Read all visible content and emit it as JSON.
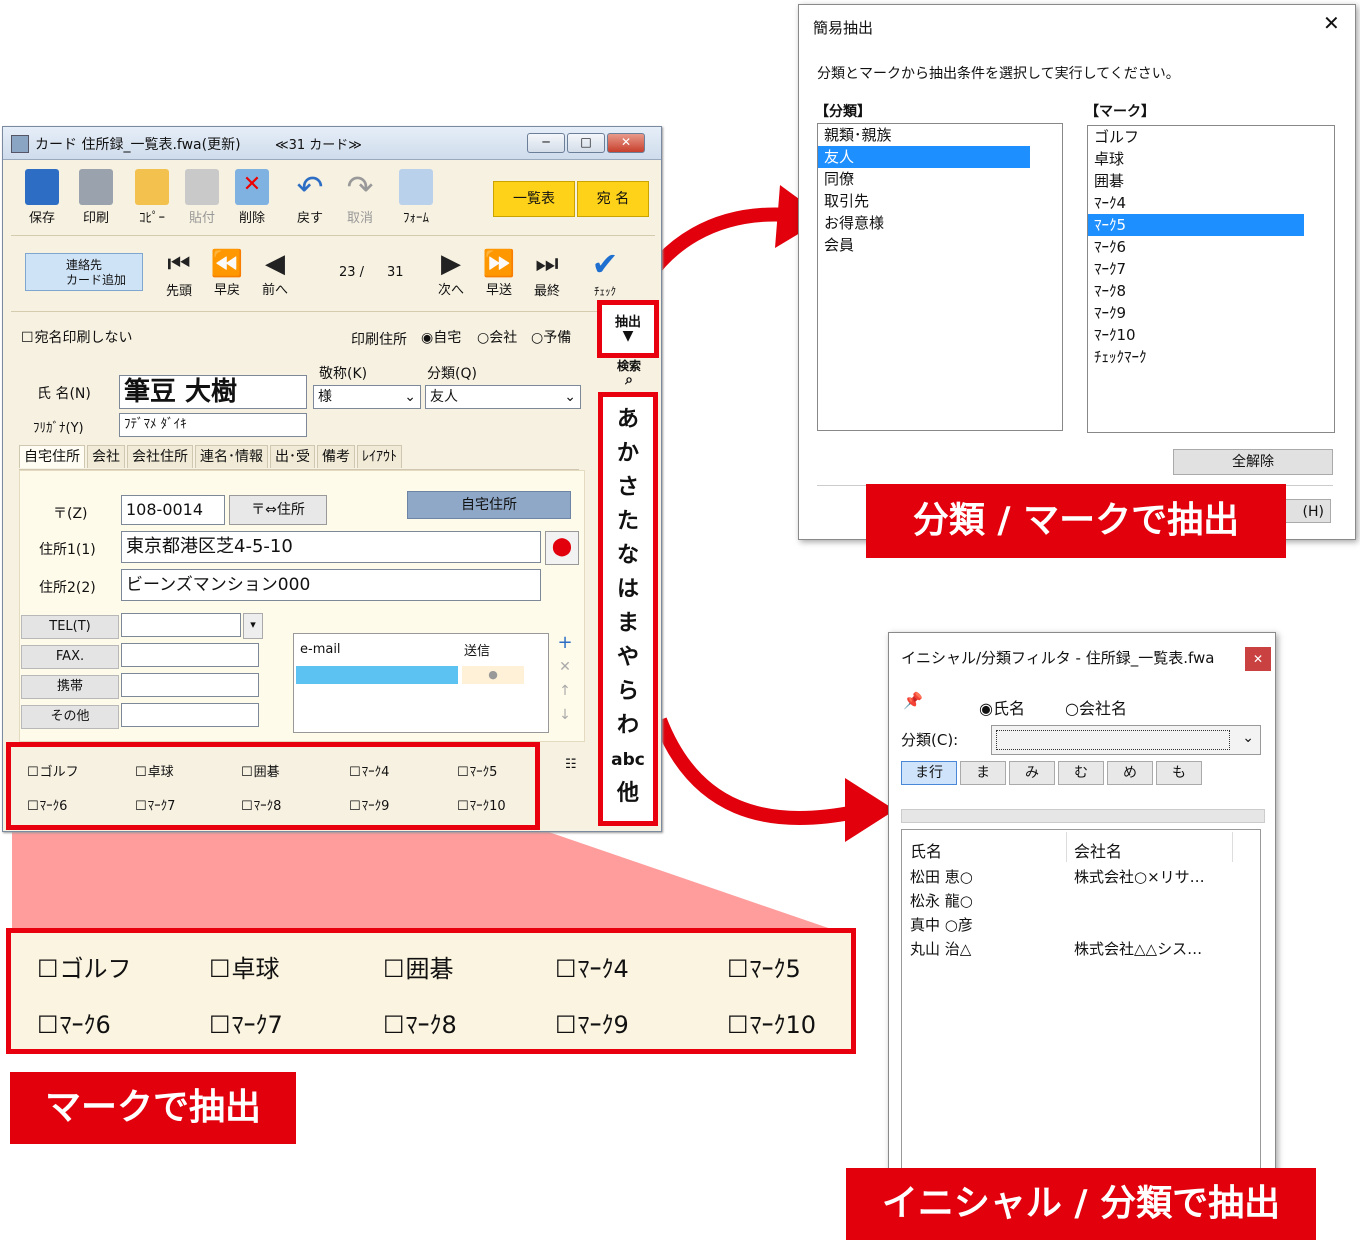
{
  "card_window": {
    "title": "カード 住所録_一覧表.fwa(更新)",
    "card_count": "≪31 カード≫",
    "toolbar": [
      "保存",
      "印刷",
      "ｺﾋﾟｰ",
      "貼付",
      "削除",
      "戻す",
      "取消",
      "ﾌｫｰﾑ"
    ],
    "list_btn": "一覧表",
    "name_btn": "宛 名",
    "add_card": "連絡先\nカード追加",
    "add_card_l1": "連絡先",
    "add_card_l2": "カード追加",
    "nav": [
      "先頭",
      "早戻",
      "前へ",
      "次へ",
      "早送",
      "最終"
    ],
    "nav_pos": "23 /",
    "nav_total": "31",
    "check_label": "ﾁｪｯｸ",
    "no_print": "宛名印刷しない",
    "print_addr_label": "印刷住所",
    "print_addr_options": [
      "自宅",
      "会社",
      "予備"
    ],
    "extract_label": "抽出",
    "search_label": "検索",
    "name_label": "氏 名(N)",
    "name_value": "筆豆 大樹",
    "kana_label": "ﾌﾘｶﾞﾅ(Y)",
    "kana_value": "ﾌﾃﾞﾏﾒ ﾀﾞｲｷ",
    "honorific_label": "敬称(K)",
    "honorific_value": "様",
    "category_label": "分類(Q)",
    "category_value": "友人",
    "tabs": [
      "自宅住所",
      "会社",
      "会社住所",
      "連名･情報",
      "出･受",
      "備考",
      "ﾚｲｱｳﾄ"
    ],
    "zip_label": "〒(Z)",
    "zip_value": "108-0014",
    "zip_btn": "〒⇔住所",
    "home_addr_hdr": "自宅住所",
    "addr1_label": "住所1(1)",
    "addr1_value": "東京都港区芝4-5-10",
    "addr2_label": "住所2(2)",
    "addr2_value": "ビーンズマンション000",
    "tel_labels": [
      "TEL(T)",
      "FAX.",
      "携帯",
      "その他"
    ],
    "email_hdr": "e-mail",
    "send_hdr": "送信",
    "marks_row1": [
      "ゴルフ",
      "卓球",
      "囲碁",
      "ﾏｰｸ4",
      "ﾏｰｸ5"
    ],
    "marks_row2": [
      "ﾏｰｸ6",
      "ﾏｰｸ7",
      "ﾏｰｸ8",
      "ﾏｰｸ9",
      "ﾏｰｸ10"
    ],
    "kana_index": [
      "あ",
      "か",
      "さ",
      "た",
      "な",
      "は",
      "ま",
      "や",
      "ら",
      "わ",
      "abc",
      "他"
    ]
  },
  "zoom_marks_row1": [
    "ゴルフ",
    "卓球",
    "囲碁",
    "ﾏｰｸ4",
    "ﾏｰｸ5"
  ],
  "zoom_marks_row2": [
    "ﾏｰｸ6",
    "ﾏｰｸ7",
    "ﾏｰｸ8",
    "ﾏｰｸ9",
    "ﾏｰｸ10"
  ],
  "simple_dialog": {
    "title": "簡易抽出",
    "instruction": "分類とマークから抽出条件を選択して実行してください。",
    "category_hdr": "【分類】",
    "mark_hdr": "【マーク】",
    "categories": [
      "親類･親族",
      "友人",
      "同僚",
      "取引先",
      "お得意様",
      "会員"
    ],
    "marks": [
      "ゴルフ",
      "卓球",
      "囲碁",
      "ﾏｰｸ4",
      "ﾏｰｸ5",
      "ﾏｰｸ6",
      "ﾏｰｸ7",
      "ﾏｰｸ8",
      "ﾏｰｸ9",
      "ﾏｰｸ10",
      "ﾁｪｯｸﾏｰｸ"
    ],
    "clear_all": "全解除",
    "help_btn": "(H)"
  },
  "filter_dialog": {
    "title": "イニシャル/分類フィルタ - 住所録_一覧表.fwa",
    "opt_name": "氏名",
    "opt_company": "会社名",
    "category_label": "分類(C):",
    "initial_buttons": [
      "ま行",
      "ま",
      "み",
      "む",
      "め",
      "も"
    ],
    "col_name": "氏名",
    "col_company": "会社名",
    "rows": [
      {
        "name": "松田 恵○",
        "company": "株式会社○×リサ…"
      },
      {
        "name": "松永 龍○",
        "company": ""
      },
      {
        "name": "真中 ○彦",
        "company": ""
      },
      {
        "name": "丸山 治△",
        "company": "株式会社△△シス…"
      }
    ]
  },
  "banners": {
    "category_mark": "分類 / マークで抽出",
    "mark": "マークで抽出",
    "initial_category": "イニシャル / 分類で抽出"
  },
  "colors": {
    "accent_red": "#e1000c",
    "selection_blue": "#1e8fff",
    "card_bg": "#f7f1e1"
  }
}
